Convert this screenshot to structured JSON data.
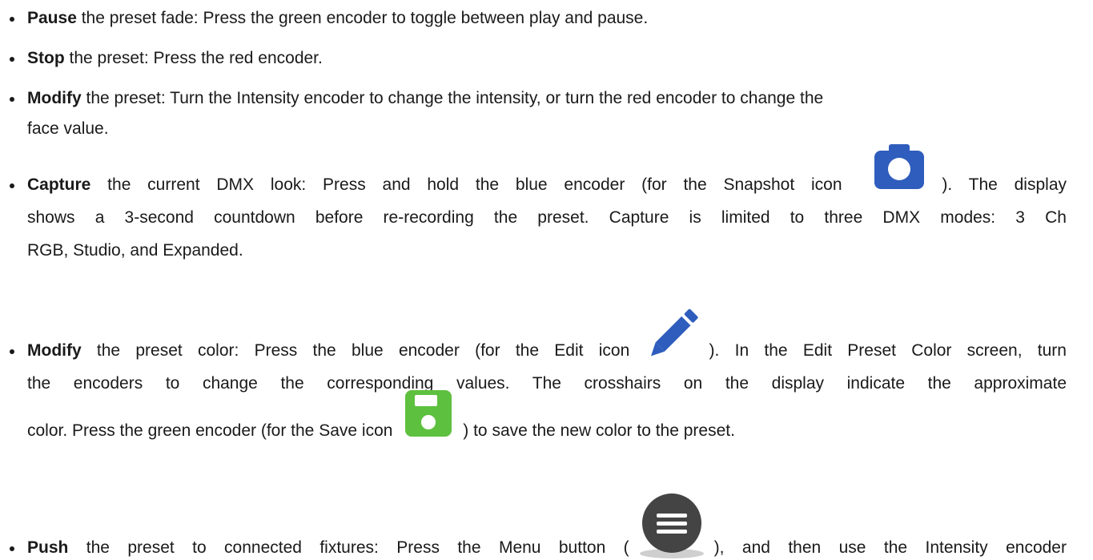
{
  "items": [
    {
      "keyword": "Pause",
      "line1": " the preset fade: Press the green encoder to toggle between play and pause."
    },
    {
      "keyword": "Stop",
      "line1": " the preset: Press the red encoder."
    },
    {
      "keyword": "Modify",
      "line1": " the preset: Turn the Intensity encoder to change the intensity, or turn the red encoder to change the",
      "line2": "face value."
    },
    {
      "keyword": "Capture",
      "line1_a": " the current DMX look: Press and hold the blue encoder (for the Snapshot icon ",
      "line1_b": "). The display",
      "line2": "shows a 3-second countdown before re-recording the preset. Capture is limited to three DMX modes: 3 Ch",
      "line3": "RGB, Studio, and Expanded."
    },
    {
      "keyword": "Modify",
      "line1_a": " the preset color: Press the blue encoder (for the Edit icon ",
      "line1_b": "). In the Edit Preset Color screen, turn",
      "line2": "the encoders to change the corresponding values. The crosshairs on the display indicate the approximate",
      "line3_a": "color. Press the green encoder (for the Save icon ",
      "line3_b": ") to save the new color to the preset."
    },
    {
      "keyword": "Push",
      "line1_a": " the preset to connected fixtures: Press the Menu button (",
      "line1_b": "), and then use the Intensity encoder"
    }
  ],
  "icons": {
    "snapshot": "camera-icon",
    "edit": "pencil-icon",
    "save": "floppy-disk-icon",
    "menu": "menu-icon"
  },
  "colors": {
    "text": "#1a1a1a",
    "blue_icon": "#2f5dbd",
    "green_icon": "#5ec03f",
    "menu_icon": "#444444"
  }
}
